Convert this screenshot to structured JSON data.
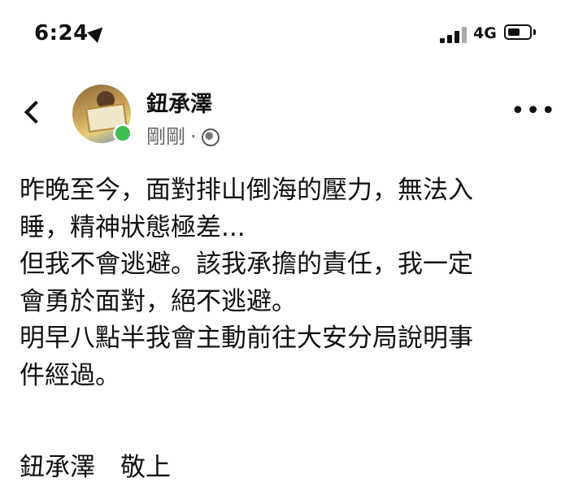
{
  "status_bar": {
    "time": "6:24",
    "network": "4G"
  },
  "header": {
    "author": "鈕承澤",
    "timestamp": "剛剛",
    "separator": "·",
    "more": "•••"
  },
  "post": {
    "lines": [
      "昨晚至今，面對排山倒海的壓力，無法入",
      "睡，精神狀態極差...",
      "但我不會逃避。該我承擔的責任，我一定",
      "會勇於面對，絕不逃避。",
      "明早八點半我會主動前往大安分局說明事",
      "件經過。"
    ],
    "signature": "鈕承澤　敬上"
  }
}
